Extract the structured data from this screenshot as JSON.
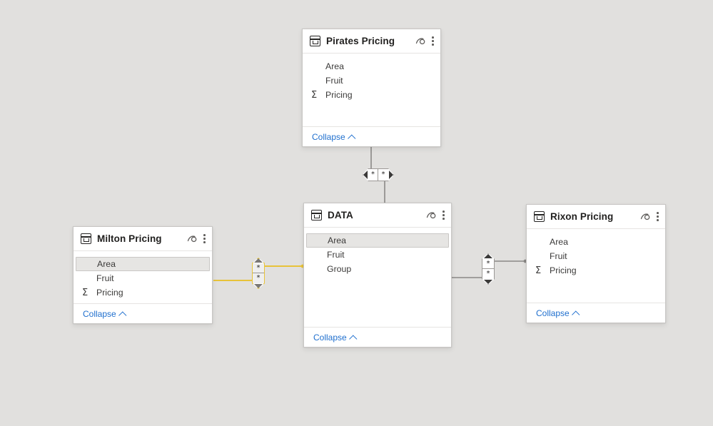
{
  "canvas": {
    "background_color": "#e1e0de",
    "view_name": "model-view"
  },
  "theme": {
    "card_background": "#ffffff",
    "card_border": "#c8c6c4",
    "link_color": "#1f6fce",
    "relationship_line": "#8a8886",
    "relationship_highlight": "#e8c33a",
    "selected_field_background": "#e6e5e3"
  },
  "icons": {
    "table": "table-icon",
    "visibility": "eye-icon",
    "more": "kebab-menu-icon",
    "measure": "Σ",
    "collapse_chevron": "chevron-up-icon"
  },
  "tables": [
    {
      "id": "pirates-pricing",
      "title": "Pirates Pricing",
      "collapse_label": "Collapse",
      "fields": [
        {
          "name": "Area",
          "type": "column",
          "selected": false
        },
        {
          "name": "Fruit",
          "type": "column",
          "selected": false
        },
        {
          "name": "Pricing",
          "type": "measure",
          "selected": false
        }
      ]
    },
    {
      "id": "data",
      "title": "DATA",
      "collapse_label": "Collapse",
      "fields": [
        {
          "name": "Area",
          "type": "column",
          "selected": true
        },
        {
          "name": "Fruit",
          "type": "column",
          "selected": false
        },
        {
          "name": "Group",
          "type": "column",
          "selected": false
        }
      ]
    },
    {
      "id": "milton-pricing",
      "title": "Milton Pricing",
      "collapse_label": "Collapse",
      "fields": [
        {
          "name": "Area",
          "type": "column",
          "selected": true
        },
        {
          "name": "Fruit",
          "type": "column",
          "selected": false
        },
        {
          "name": "Pricing",
          "type": "measure",
          "selected": false
        }
      ]
    },
    {
      "id": "rixon-pricing",
      "title": "Rixon Pricing",
      "collapse_label": "Collapse",
      "fields": [
        {
          "name": "Area",
          "type": "column",
          "selected": false
        },
        {
          "name": "Fruit",
          "type": "column",
          "selected": false
        },
        {
          "name": "Pricing",
          "type": "measure",
          "selected": false
        }
      ]
    }
  ],
  "relationships": [
    {
      "id": "rel-pirates-data",
      "from": "Pirates Pricing",
      "to": "DATA",
      "cardinality_from": "*",
      "cardinality_to": "*",
      "cross_filter": "both",
      "orientation": "horizontal",
      "highlighted": false
    },
    {
      "id": "rel-milton-data",
      "from": "Milton Pricing",
      "to": "DATA",
      "cardinality_from": "*",
      "cardinality_to": "*",
      "cross_filter": "both",
      "orientation": "vertical",
      "highlighted": true
    },
    {
      "id": "rel-data-rixon",
      "from": "DATA",
      "to": "Rixon Pricing",
      "cardinality_from": "*",
      "cardinality_to": "*",
      "cross_filter": "both",
      "orientation": "vertical",
      "highlighted": false
    }
  ]
}
